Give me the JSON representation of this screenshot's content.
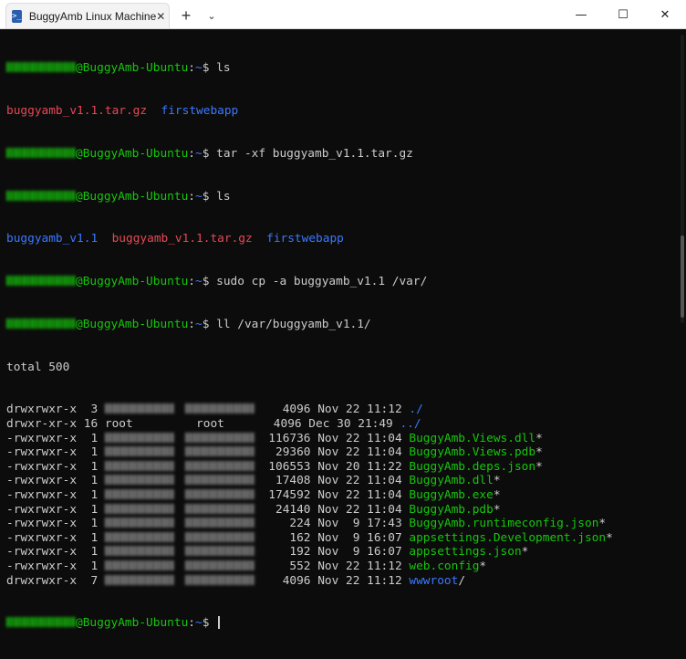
{
  "window": {
    "tab_title": "BuggyAmb Linux Machine",
    "tab_icon": ">_",
    "tab_close": "✕",
    "new_tab": "+",
    "dropdown": "⌄",
    "minimize": "—",
    "maximize": "☐",
    "close": "✕"
  },
  "prompt": {
    "host": "@BuggyAmb-Ubuntu",
    "path": "~",
    "symbol": "$"
  },
  "commands": [
    " ls",
    " tar -xf buggyamb_v1.1.tar.gz",
    " ls",
    " sudo cp -a buggyamb_v1.1 /var/",
    " ll /var/buggyamb_v1.1/",
    " "
  ],
  "ls1": {
    "a": "buggyamb_v1.1.tar.gz",
    "b": "firstwebapp"
  },
  "ls2": {
    "a": "buggyamb_v1.1",
    "b": "buggyamb_v1.1.tar.gz",
    "c": "firstwebapp"
  },
  "total": "total 500",
  "listing": [
    {
      "perm": "drwxrwxr-x",
      "links": "3",
      "owner": "",
      "group": "",
      "size": "4096",
      "month": "Nov",
      "day": "22",
      "time": "11:12",
      "name": "./",
      "suffix": "",
      "color": "blue"
    },
    {
      "perm": "drwxr-xr-x",
      "links": "16",
      "owner": "root",
      "group": "root",
      "size": "4096",
      "month": "Dec",
      "day": "30",
      "time": "21:49",
      "name": "../",
      "suffix": "",
      "color": "blue"
    },
    {
      "perm": "-rwxrwxr-x",
      "links": "1",
      "owner": "",
      "group": "",
      "size": "116736",
      "month": "Nov",
      "day": "22",
      "time": "11:04",
      "name": "BuggyAmb.Views.dll",
      "suffix": "*",
      "color": "green"
    },
    {
      "perm": "-rwxrwxr-x",
      "links": "1",
      "owner": "",
      "group": "",
      "size": "29360",
      "month": "Nov",
      "day": "22",
      "time": "11:04",
      "name": "BuggyAmb.Views.pdb",
      "suffix": "*",
      "color": "green"
    },
    {
      "perm": "-rwxrwxr-x",
      "links": "1",
      "owner": "",
      "group": "",
      "size": "106553",
      "month": "Nov",
      "day": "20",
      "time": "11:22",
      "name": "BuggyAmb.deps.json",
      "suffix": "*",
      "color": "green"
    },
    {
      "perm": "-rwxrwxr-x",
      "links": "1",
      "owner": "",
      "group": "",
      "size": "17408",
      "month": "Nov",
      "day": "22",
      "time": "11:04",
      "name": "BuggyAmb.dll",
      "suffix": "*",
      "color": "green"
    },
    {
      "perm": "-rwxrwxr-x",
      "links": "1",
      "owner": "",
      "group": "",
      "size": "174592",
      "month": "Nov",
      "day": "22",
      "time": "11:04",
      "name": "BuggyAmb.exe",
      "suffix": "*",
      "color": "green"
    },
    {
      "perm": "-rwxrwxr-x",
      "links": "1",
      "owner": "",
      "group": "",
      "size": "24140",
      "month": "Nov",
      "day": "22",
      "time": "11:04",
      "name": "BuggyAmb.pdb",
      "suffix": "*",
      "color": "green"
    },
    {
      "perm": "-rwxrwxr-x",
      "links": "1",
      "owner": "",
      "group": "",
      "size": "224",
      "month": "Nov",
      "day": "9",
      "time": "17:43",
      "name": "BuggyAmb.runtimeconfig.json",
      "suffix": "*",
      "color": "green"
    },
    {
      "perm": "-rwxrwxr-x",
      "links": "1",
      "owner": "",
      "group": "",
      "size": "162",
      "month": "Nov",
      "day": "9",
      "time": "16:07",
      "name": "appsettings.Development.json",
      "suffix": "*",
      "color": "green"
    },
    {
      "perm": "-rwxrwxr-x",
      "links": "1",
      "owner": "",
      "group": "",
      "size": "192",
      "month": "Nov",
      "day": "9",
      "time": "16:07",
      "name": "appsettings.json",
      "suffix": "*",
      "color": "green"
    },
    {
      "perm": "-rwxrwxr-x",
      "links": "1",
      "owner": "",
      "group": "",
      "size": "552",
      "month": "Nov",
      "day": "22",
      "time": "11:12",
      "name": "web.config",
      "suffix": "*",
      "color": "green"
    },
    {
      "perm": "drwxrwxr-x",
      "links": "7",
      "owner": "",
      "group": "",
      "size": "4096",
      "month": "Nov",
      "day": "22",
      "time": "11:12",
      "name": "wwwroot",
      "suffix": "/",
      "color": "blue"
    }
  ]
}
